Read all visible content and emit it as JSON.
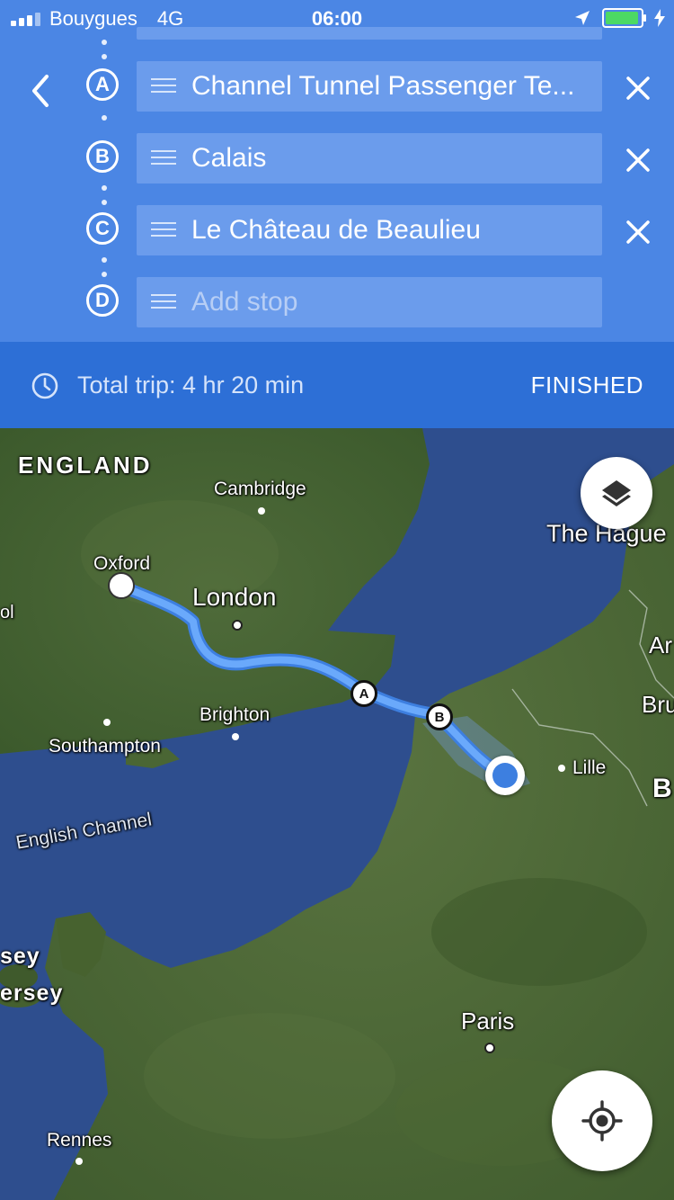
{
  "status_bar": {
    "carrier": "Bouygues",
    "network": "4G",
    "time": "06:00",
    "battery_color": "#4cd964"
  },
  "header": {
    "back_icon": "chevron-left-icon",
    "bg_color": "#4b86e4",
    "stops": [
      {
        "letter": "A",
        "value": "Channel Tunnel Passenger Te..."
      },
      {
        "letter": "B",
        "value": "Calais"
      },
      {
        "letter": "C",
        "value": "Le Château de Beaulieu"
      },
      {
        "letter": "D",
        "placeholder": "Add stop"
      }
    ]
  },
  "trip_bar": {
    "total": "Total trip: 4 hr 20 min",
    "finished_label": "FINISHED",
    "bg_color": "#2d6fd6"
  },
  "map": {
    "labels": {
      "england": "ENGLAND",
      "cambridge": "Cambridge",
      "the_hague": "The Hague",
      "oxford": "Oxford",
      "london": "London",
      "brighton": "Brighton",
      "southampton": "Southampton",
      "english_channel": "English Channel",
      "lille": "Lille",
      "paris": "Paris",
      "rennes": "Rennes",
      "guernsey_partial": "sey",
      "jersey_partial": "ersey",
      "bristol_partial": "ol",
      "antwerp_partial": "Ar",
      "brussels_partial": "Bru",
      "belgium_partial": "B"
    },
    "waypoints": {
      "a": "A",
      "b": "B"
    },
    "route_color": "#5a9cf8",
    "layers_icon": "layers-icon",
    "locate_icon": "my-location-icon"
  }
}
